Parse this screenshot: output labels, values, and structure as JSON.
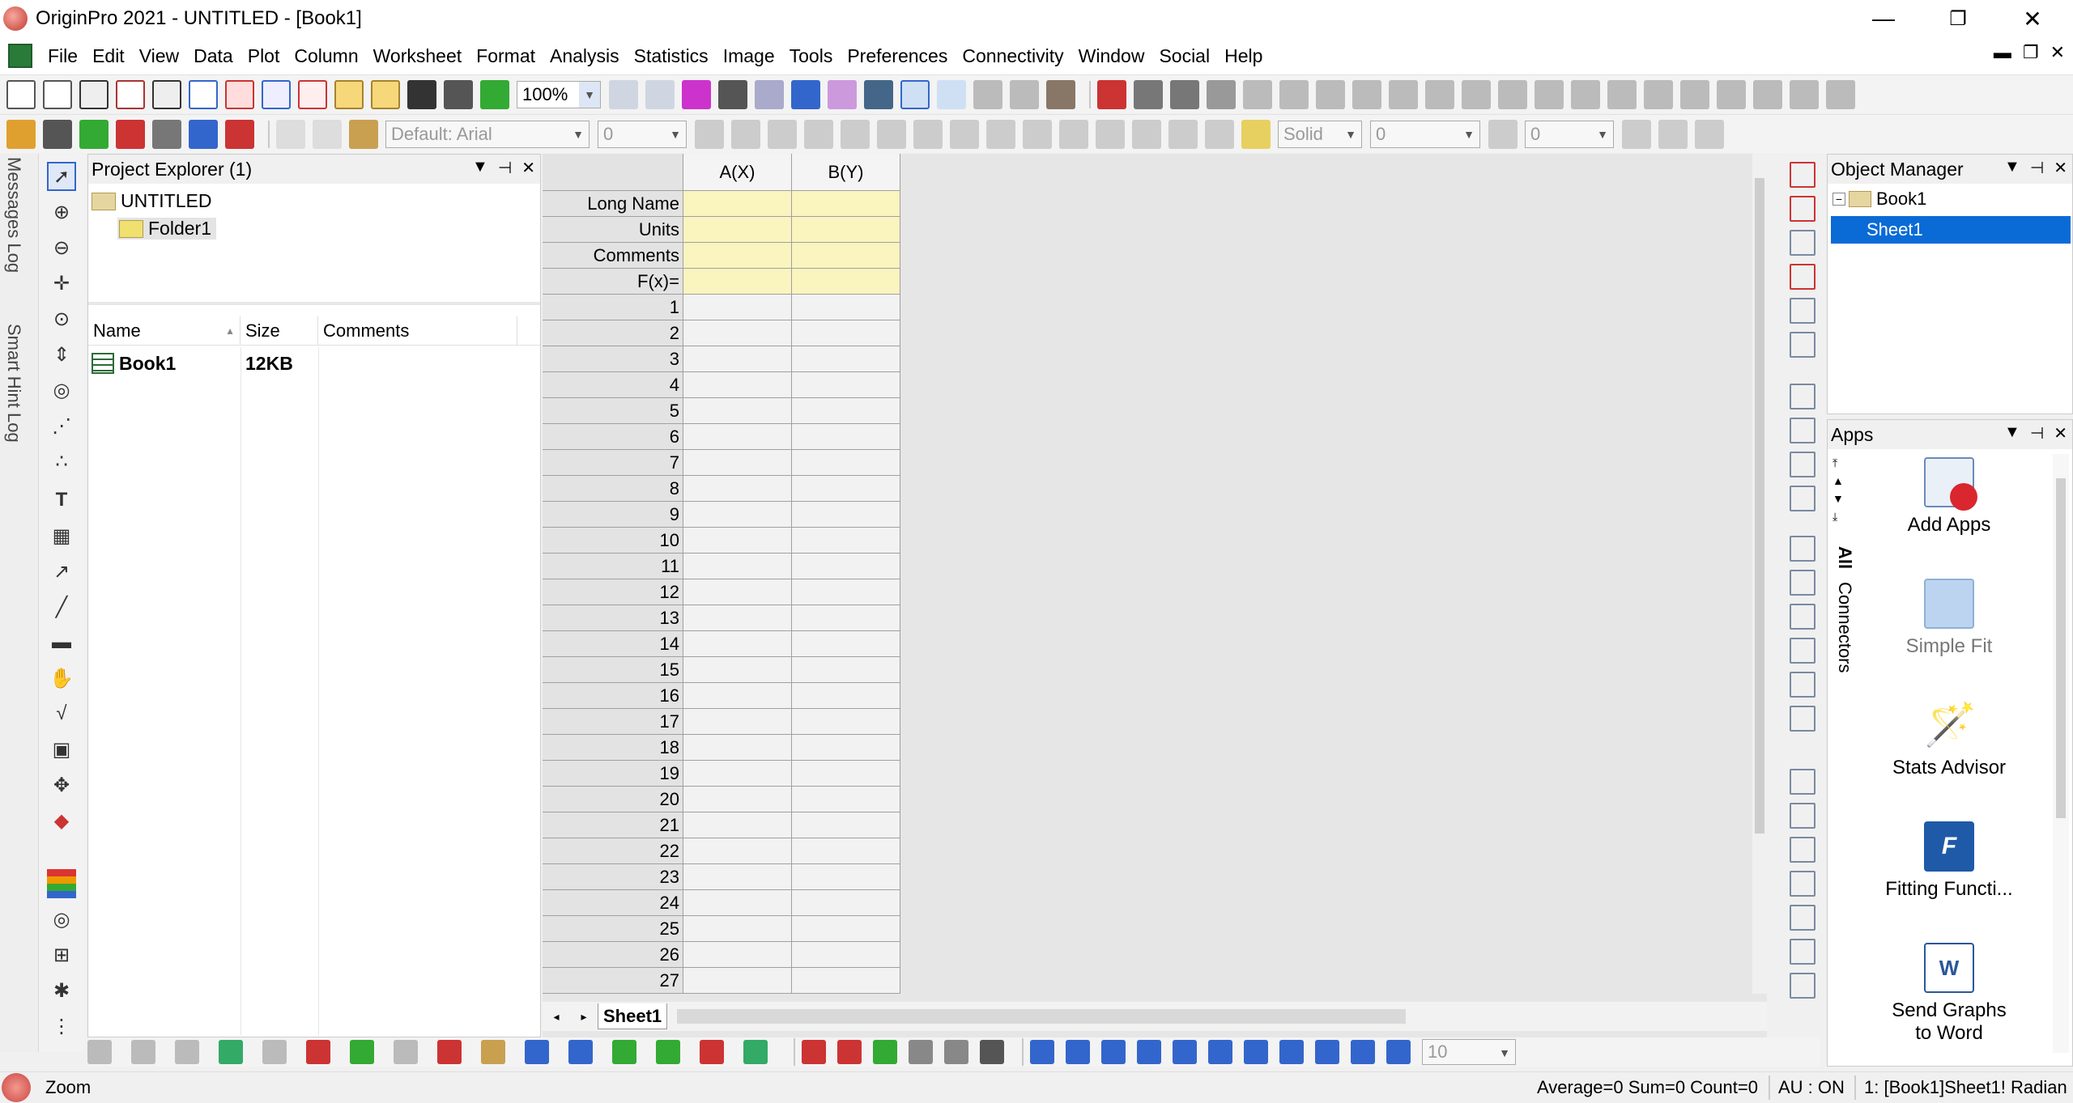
{
  "window": {
    "title": "OriginPro 2021 - UNTITLED - [Book1]",
    "minimize": "—",
    "maximize": "❐",
    "close": "✕"
  },
  "menu": [
    "File",
    "Edit",
    "View",
    "Data",
    "Plot",
    "Column",
    "Worksheet",
    "Format",
    "Analysis",
    "Statistics",
    "Image",
    "Tools",
    "Preferences",
    "Connectivity",
    "Window",
    "Social",
    "Help"
  ],
  "toolbar": {
    "zoom": "100%",
    "font": "Default: Arial",
    "font_size": "0",
    "line_style": "Solid",
    "line_width": "0",
    "fill_value": "0",
    "bottom_size": "10"
  },
  "left_tabs": {
    "messages": "Messages Log",
    "smart_hint": "Smart Hint Log"
  },
  "project_explorer": {
    "title": "Project Explorer (1)",
    "tree": {
      "root": "UNTITLED",
      "folder": "Folder1"
    },
    "columns": [
      "Name",
      "Size",
      "Comments"
    ],
    "rows": [
      {
        "name": "Book1",
        "size": "12KB",
        "comments": ""
      }
    ]
  },
  "worksheet": {
    "columns": [
      "A(X)",
      "B(Y)"
    ],
    "meta_rows": [
      "Long Name",
      "Units",
      "Comments",
      "F(x)="
    ],
    "rows": [
      "1",
      "2",
      "3",
      "4",
      "5",
      "6",
      "7",
      "8",
      "9",
      "10",
      "11",
      "12",
      "13",
      "14",
      "15",
      "16",
      "17",
      "18",
      "19",
      "20",
      "21",
      "22",
      "23",
      "24",
      "25",
      "26",
      "27"
    ],
    "sheet_tab": "Sheet1"
  },
  "object_manager": {
    "title": "Object Manager",
    "book": "Book1",
    "sheet": "Sheet1"
  },
  "apps": {
    "title": "Apps",
    "tabs": [
      "All",
      "Connectors"
    ],
    "tiles": [
      {
        "label": "Add Apps"
      },
      {
        "label": "Simple Fit"
      },
      {
        "label": "Stats Advisor"
      },
      {
        "label": "Fitting Functi..."
      },
      {
        "label": "Send Graphs to Word"
      }
    ]
  },
  "status": {
    "left": "Zoom",
    "stats": "Average=0 Sum=0 Count=0",
    "au": "AU : ON",
    "context": "1: [Book1]Sheet1! Radian"
  },
  "colors": {
    "selection": "#0a6bd6",
    "meta_cells": "#faf4bf",
    "row_header": "#e3e3e3"
  }
}
